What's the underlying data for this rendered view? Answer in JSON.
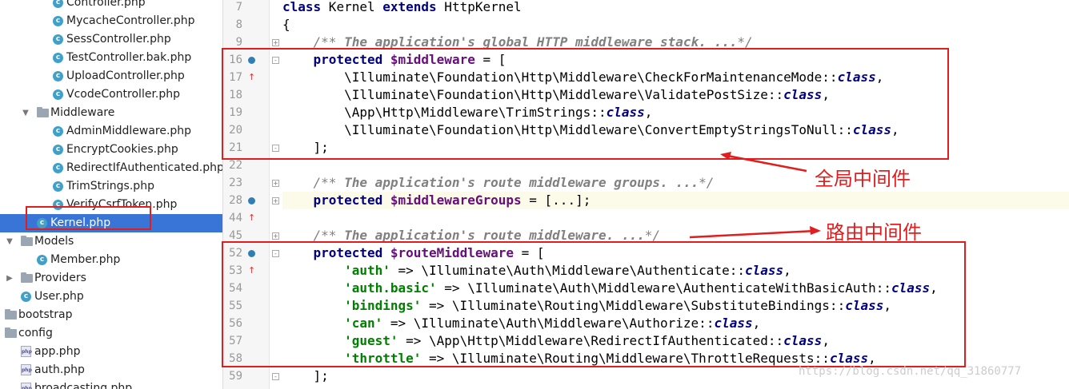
{
  "project_tree": [
    {
      "label": "Controller.php",
      "indent": 66,
      "icon": "class"
    },
    {
      "label": "MycacheController.php",
      "indent": 66,
      "icon": "class"
    },
    {
      "label": "SessController.php",
      "indent": 66,
      "icon": "class"
    },
    {
      "label": "TestController.bak.php",
      "indent": 66,
      "icon": "class"
    },
    {
      "label": "UploadController.php",
      "indent": 66,
      "icon": "class"
    },
    {
      "label": "VcodeController.php",
      "indent": 66,
      "icon": "class"
    },
    {
      "label": "Middleware",
      "indent": 46,
      "icon": "folder",
      "arrow": "▼"
    },
    {
      "label": "AdminMiddleware.php",
      "indent": 66,
      "icon": "class"
    },
    {
      "label": "EncryptCookies.php",
      "indent": 66,
      "icon": "class"
    },
    {
      "label": "RedirectIfAuthenticated.php",
      "indent": 66,
      "icon": "class"
    },
    {
      "label": "TrimStrings.php",
      "indent": 66,
      "icon": "class"
    },
    {
      "label": "VerifyCsrfToken.php",
      "indent": 66,
      "icon": "class"
    },
    {
      "label": "Kernel.php",
      "indent": 46,
      "icon": "class",
      "selected": true
    },
    {
      "label": "Models",
      "indent": 26,
      "icon": "folder",
      "arrow": "▼"
    },
    {
      "label": "Member.php",
      "indent": 46,
      "icon": "class"
    },
    {
      "label": "Providers",
      "indent": 26,
      "icon": "folder",
      "arrow": "▶"
    },
    {
      "label": "User.php",
      "indent": 26,
      "icon": "class"
    },
    {
      "label": "bootstrap",
      "indent": 6,
      "icon": "folder"
    },
    {
      "label": "config",
      "indent": 6,
      "icon": "folder"
    },
    {
      "label": "app.php",
      "indent": 26,
      "icon": "php"
    },
    {
      "label": "auth.php",
      "indent": 26,
      "icon": "php"
    },
    {
      "label": "broadcasting.php",
      "indent": 26,
      "icon": "php"
    }
  ],
  "gutter_lines": [
    {
      "n": "7",
      "marker": false,
      "fold": ""
    },
    {
      "n": "8",
      "marker": false,
      "fold": ""
    },
    {
      "n": "9",
      "marker": false,
      "fold": "+"
    },
    {
      "n": "16",
      "marker": true,
      "fold": "-"
    },
    {
      "n": "17",
      "marker": false,
      "fold": ""
    },
    {
      "n": "18",
      "marker": false,
      "fold": ""
    },
    {
      "n": "19",
      "marker": false,
      "fold": ""
    },
    {
      "n": "20",
      "marker": false,
      "fold": ""
    },
    {
      "n": "21",
      "marker": false,
      "fold": "-"
    },
    {
      "n": "22",
      "marker": false,
      "fold": ""
    },
    {
      "n": "23",
      "marker": false,
      "fold": "+"
    },
    {
      "n": "28",
      "marker": true,
      "fold": "+"
    },
    {
      "n": "44",
      "marker": false,
      "fold": ""
    },
    {
      "n": "45",
      "marker": false,
      "fold": "+"
    },
    {
      "n": "52",
      "marker": true,
      "fold": "-"
    },
    {
      "n": "53",
      "marker": false,
      "fold": ""
    },
    {
      "n": "54",
      "marker": false,
      "fold": ""
    },
    {
      "n": "55",
      "marker": false,
      "fold": ""
    },
    {
      "n": "56",
      "marker": false,
      "fold": ""
    },
    {
      "n": "57",
      "marker": false,
      "fold": ""
    },
    {
      "n": "58",
      "marker": false,
      "fold": ""
    },
    {
      "n": "59",
      "marker": false,
      "fold": "-"
    }
  ],
  "code_lines": [
    {
      "tokens": [
        [
          "kw",
          "class"
        ],
        [
          "p",
          " Kernel "
        ],
        [
          "kw",
          "extends"
        ],
        [
          "p",
          " HttpKernel"
        ]
      ]
    },
    {
      "tokens": [
        [
          "p",
          "{"
        ]
      ]
    },
    {
      "tokens": [
        [
          "p",
          "    "
        ],
        [
          "cm",
          "/** "
        ],
        [
          "cmb",
          "The application's global HTTP middleware stack. ..."
        ],
        [
          "cm",
          "*/"
        ]
      ]
    },
    {
      "tokens": [
        [
          "p",
          "    "
        ],
        [
          "kw",
          "protected"
        ],
        [
          "p",
          " "
        ],
        [
          "var",
          "$middleware"
        ],
        [
          "p",
          " = ["
        ]
      ]
    },
    {
      "tokens": [
        [
          "p",
          "        \\Illuminate\\Foundation\\Http\\Middleware\\CheckForMaintenanceMode::"
        ],
        [
          "cls",
          "class"
        ],
        [
          "p",
          ","
        ]
      ]
    },
    {
      "tokens": [
        [
          "p",
          "        \\Illuminate\\Foundation\\Http\\Middleware\\ValidatePostSize::"
        ],
        [
          "cls",
          "class"
        ],
        [
          "p",
          ","
        ]
      ]
    },
    {
      "tokens": [
        [
          "p",
          "        \\App\\Http\\Middleware\\TrimStrings::"
        ],
        [
          "cls",
          "class"
        ],
        [
          "p",
          ","
        ]
      ]
    },
    {
      "tokens": [
        [
          "p",
          "        \\Illuminate\\Foundation\\Http\\Middleware\\ConvertEmptyStringsToNull::"
        ],
        [
          "cls",
          "class"
        ],
        [
          "p",
          ","
        ]
      ]
    },
    {
      "tokens": [
        [
          "p",
          "    ];"
        ]
      ]
    },
    {
      "tokens": [
        [
          "p",
          ""
        ]
      ]
    },
    {
      "tokens": [
        [
          "p",
          "    "
        ],
        [
          "cm",
          "/** "
        ],
        [
          "cmb",
          "The application's route middleware groups. ..."
        ],
        [
          "cm",
          "*/"
        ]
      ]
    },
    {
      "tokens": [
        [
          "p",
          "    "
        ],
        [
          "kw",
          "protected"
        ],
        [
          "p",
          " "
        ],
        [
          "var",
          "$middlewareGroups"
        ],
        [
          "p",
          " = [...];"
        ]
      ],
      "highlight": true
    },
    {
      "tokens": [
        [
          "p",
          ""
        ]
      ]
    },
    {
      "tokens": [
        [
          "p",
          "    "
        ],
        [
          "cm",
          "/** "
        ],
        [
          "cmb",
          "The application's route middleware. ..."
        ],
        [
          "cm",
          "*/"
        ]
      ]
    },
    {
      "tokens": [
        [
          "p",
          "    "
        ],
        [
          "kw",
          "protected"
        ],
        [
          "p",
          " "
        ],
        [
          "var",
          "$routeMiddleware"
        ],
        [
          "p",
          " = ["
        ]
      ]
    },
    {
      "tokens": [
        [
          "p",
          "        "
        ],
        [
          "str",
          "'auth'"
        ],
        [
          "p",
          " => \\Illuminate\\Auth\\Middleware\\Authenticate::"
        ],
        [
          "cls",
          "class"
        ],
        [
          "p",
          ","
        ]
      ]
    },
    {
      "tokens": [
        [
          "p",
          "        "
        ],
        [
          "str",
          "'auth.basic'"
        ],
        [
          "p",
          " => \\Illuminate\\Auth\\Middleware\\AuthenticateWithBasicAuth::"
        ],
        [
          "cls",
          "class"
        ],
        [
          "p",
          ","
        ]
      ]
    },
    {
      "tokens": [
        [
          "p",
          "        "
        ],
        [
          "str",
          "'bindings'"
        ],
        [
          "p",
          " => \\Illuminate\\Routing\\Middleware\\SubstituteBindings::"
        ],
        [
          "cls",
          "class"
        ],
        [
          "p",
          ","
        ]
      ]
    },
    {
      "tokens": [
        [
          "p",
          "        "
        ],
        [
          "str",
          "'can'"
        ],
        [
          "p",
          " => \\Illuminate\\Auth\\Middleware\\Authorize::"
        ],
        [
          "cls",
          "class"
        ],
        [
          "p",
          ","
        ]
      ]
    },
    {
      "tokens": [
        [
          "p",
          "        "
        ],
        [
          "str",
          "'guest'"
        ],
        [
          "p",
          " => \\App\\Http\\Middleware\\RedirectIfAuthenticated::"
        ],
        [
          "cls",
          "class"
        ],
        [
          "p",
          ","
        ]
      ]
    },
    {
      "tokens": [
        [
          "p",
          "        "
        ],
        [
          "str",
          "'throttle'"
        ],
        [
          "p",
          " => \\Illuminate\\Routing\\Middleware\\ThrottleRequests::"
        ],
        [
          "cls",
          "class"
        ],
        [
          "p",
          ","
        ]
      ]
    },
    {
      "tokens": [
        [
          "p",
          "    ];"
        ]
      ]
    }
  ],
  "annotations": {
    "global_label": "全局中间件",
    "route_label": "路由中间件"
  },
  "watermark": "https://blog.csdn.net/qq_31860777",
  "colors": {
    "highlight_box": "#e11d1d",
    "selection": "#3875d7",
    "keyword": "#000080",
    "variable": "#660e7a",
    "string": "#008000",
    "comment": "#808080"
  }
}
